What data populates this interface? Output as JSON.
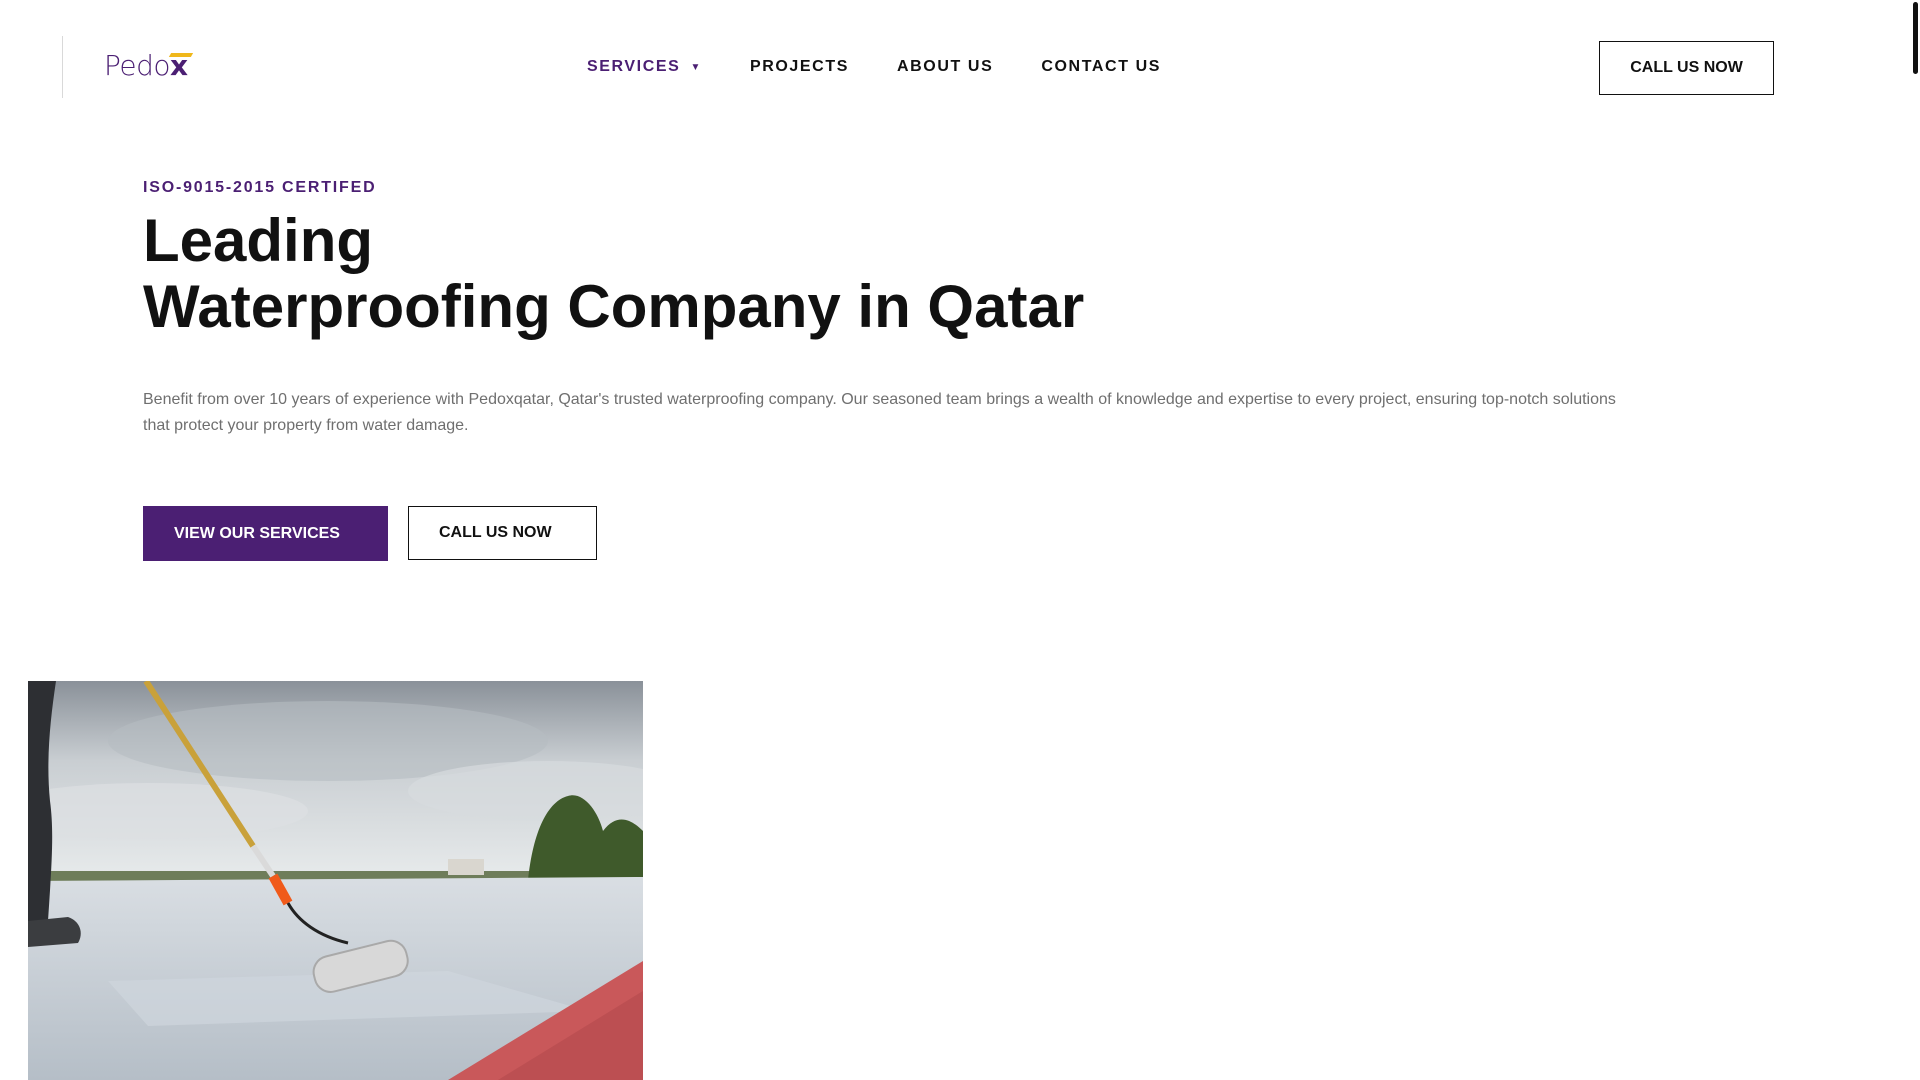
{
  "brand": {
    "logo_text": "Pedo",
    "logo_x": "x",
    "colors": {
      "primary": "#4b1f73",
      "accent": "#f0b81b",
      "text": "#111111",
      "muted": "#6f6f6f"
    }
  },
  "nav": {
    "items": [
      {
        "label": "SERVICES",
        "has_dropdown": true
      },
      {
        "label": "PROJECTS"
      },
      {
        "label": "ABOUT US"
      },
      {
        "label": "CONTACT US"
      }
    ],
    "caret": "▼"
  },
  "header": {
    "cta_label": "CALL US NOW"
  },
  "hero": {
    "eyebrow": "ISO-9015-2015 CERTIFED",
    "title_line1": "Leading",
    "title_line2": "Waterproofing Company in Qatar",
    "description": "Benefit from over 10 years of experience with Pedoxqatar, Qatar's trusted waterproofing company. Our seasoned team brings a wealth of knowledge and expertise to every project, ensuring top-notch solutions that protect your property from water damage.",
    "primary_button": "VIEW OUR SERVICES",
    "secondary_button": "CALL US NOW"
  },
  "hero_image": {
    "icon": "roof-painting-photo"
  }
}
